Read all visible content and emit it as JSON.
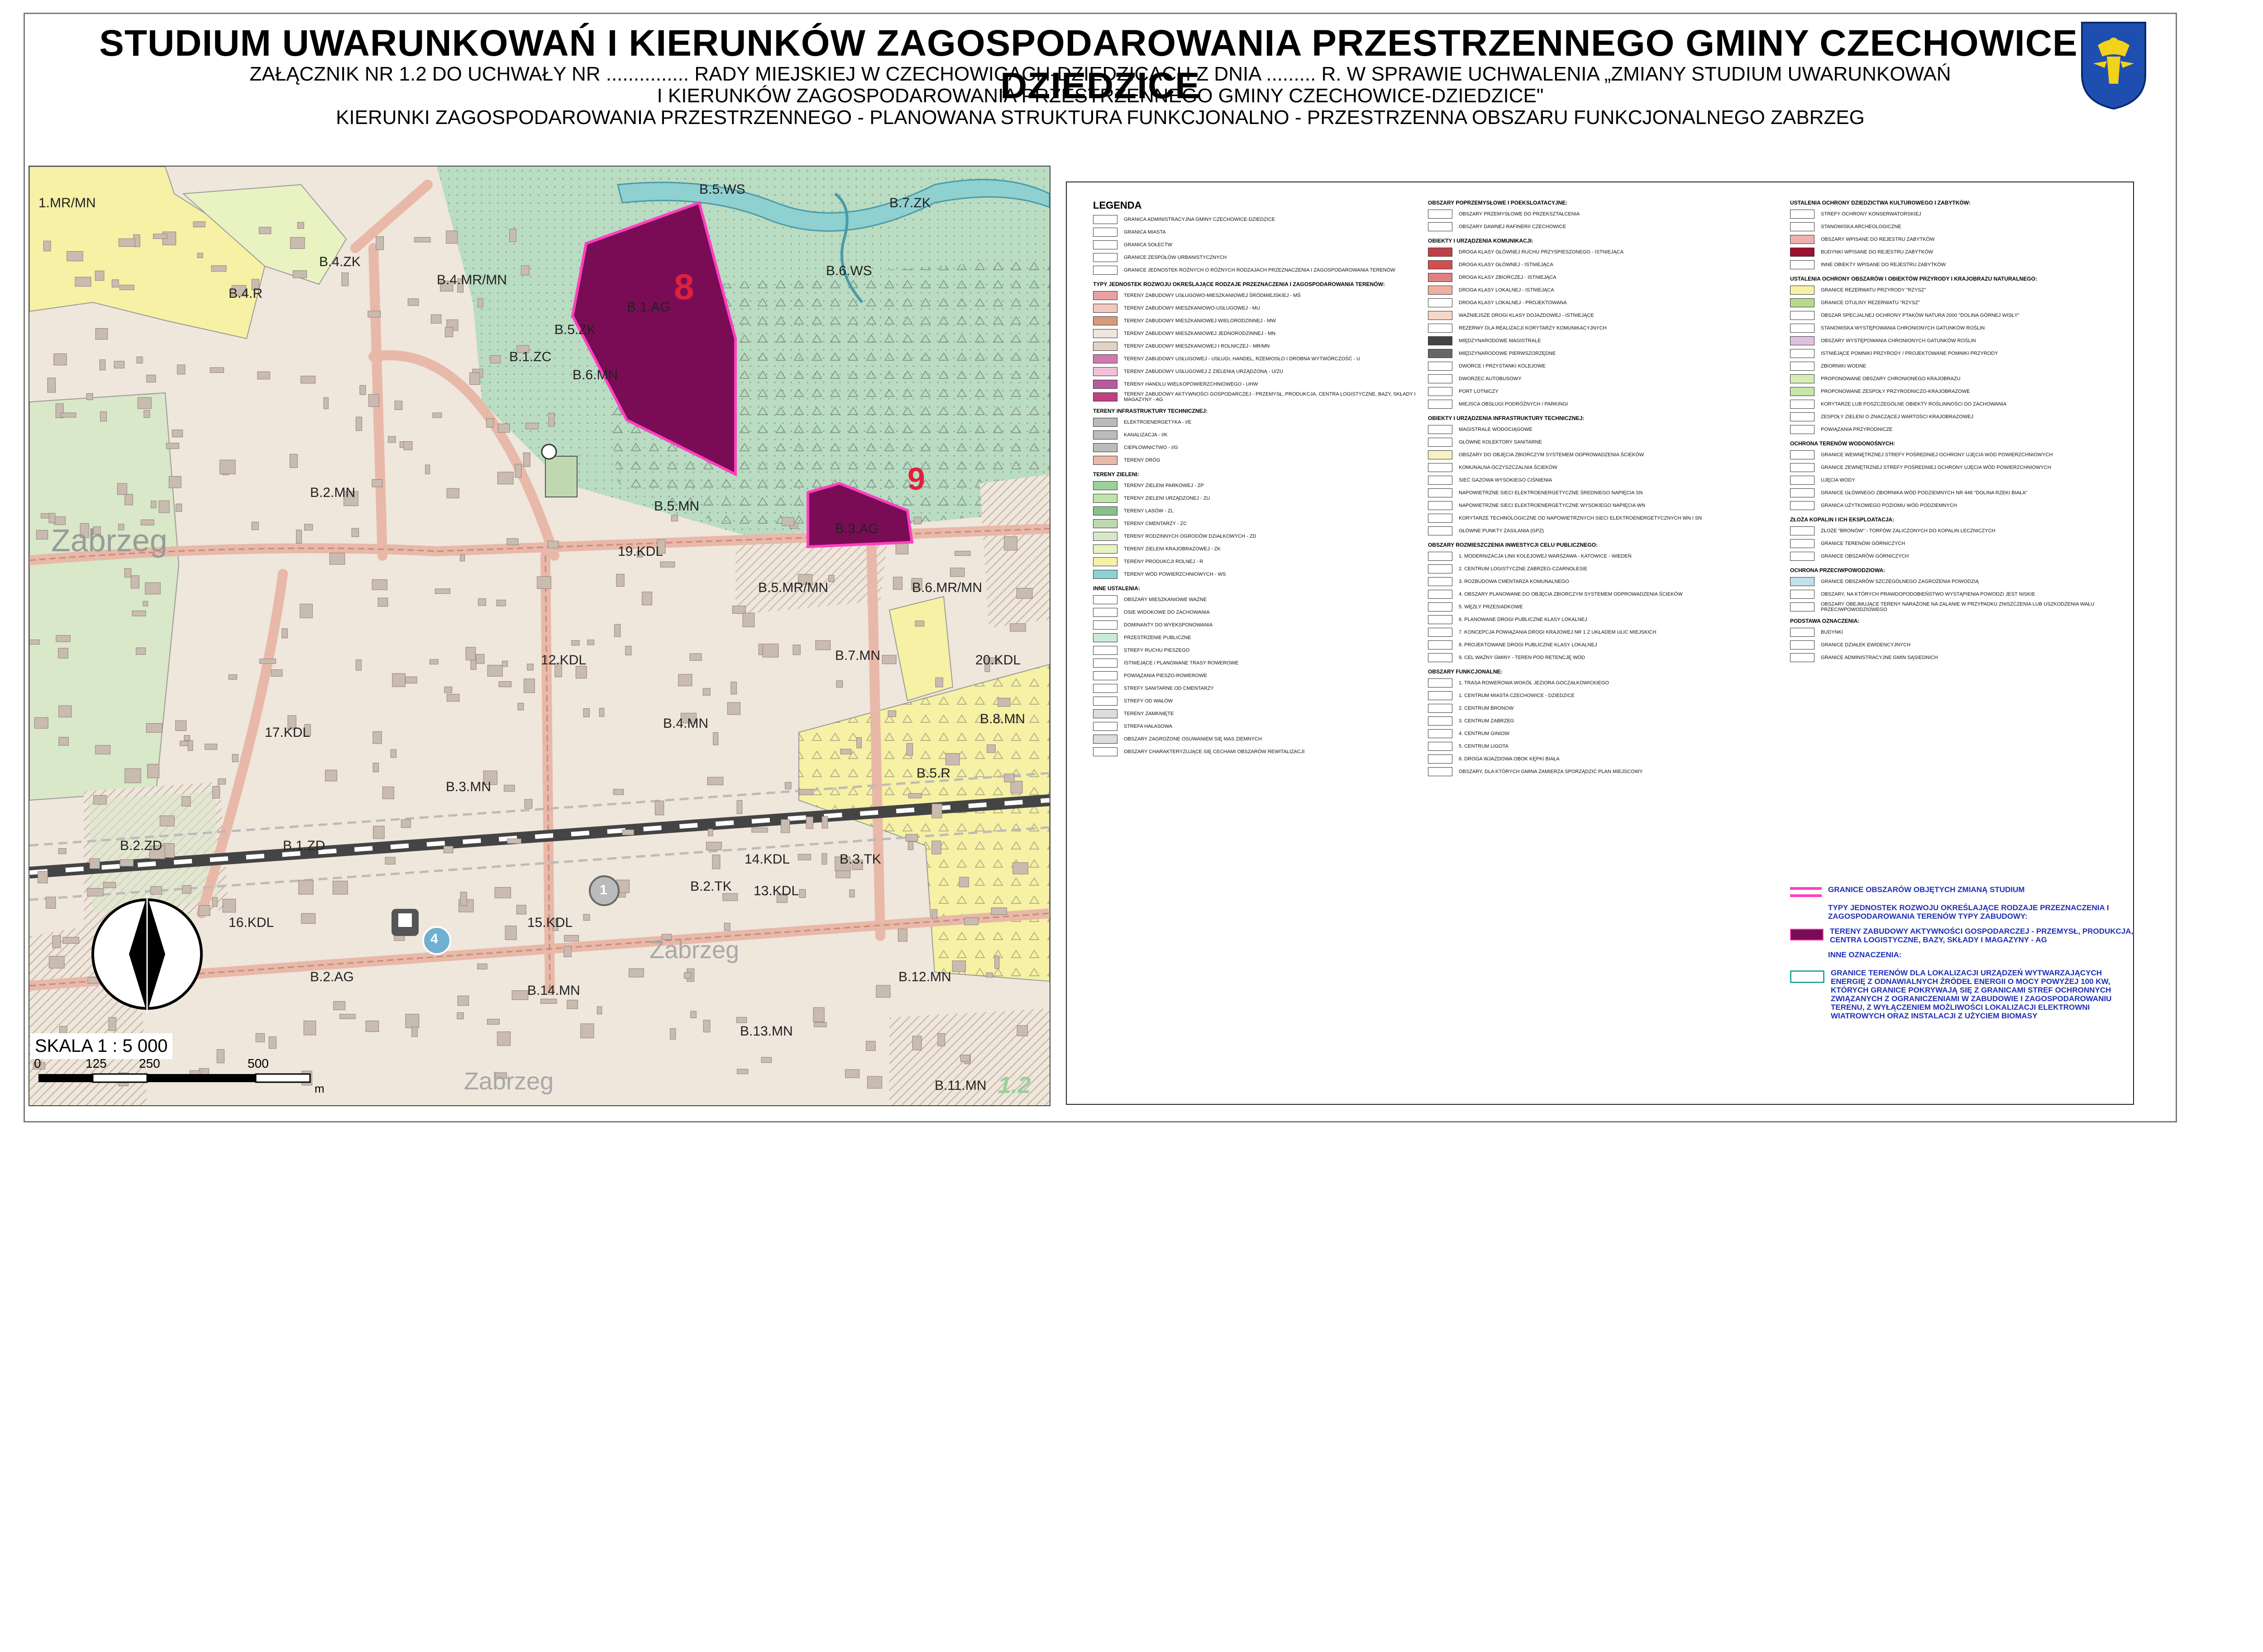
{
  "title": {
    "main": "STUDIUM UWARUNKOWAŃ I KIERUNKÓW ZAGOSPODAROWANIA PRZESTRZENNEGO GMINY CZECHOWICE - DZIEDZICE",
    "line2": "ZAŁĄCZNIK NR 1.2 DO UCHWAŁY NR ............... RADY MIEJSKIEJ W CZECHOWICACH-DZIEDZICACH Z DNIA ......... R. W SPRAWIE UCHWALENIA „ZMIANY STUDIUM UWARUNKOWAŃ",
    "line3": "I KIERUNKÓW ZAGOSPODAROWANIA PRZESTRZENNEGO GMINY CZECHOWICE-DZIEDZICE\"",
    "line4": "KIERUNKI ZAGOSPODAROWANIA PRZESTRZENNEGO - PLANOWANA STRUKTURA FUNKCJONALNO - PRZESTRZENNA OBSZARU FUNKCJONALNEGO ZABRZEG"
  },
  "colors": {
    "residential": "#efe6dc",
    "service_mixed": "#f6f1a4",
    "agri": "#e9f3c2",
    "meadow": "#c9e6d0",
    "forest": "#d8e8c8",
    "water": "#8fd0d0",
    "change_area": "#7a0c55",
    "change_border": "#ff40c0",
    "road": "#e8b8a8",
    "railway": "#444444",
    "blue_text": "#1d2fb8"
  },
  "map": {
    "place_name": "Zabrzeg",
    "place_name_2": "Zabrzeg",
    "place_name_3": "Zabrzeg",
    "sheet_no": "1.2",
    "scale_text": "SKALA 1 : 5 000",
    "scale_ticks": [
      "0",
      "125",
      "250",
      "500"
    ],
    "scale_unit": "m",
    "zones": [
      {
        "id": "1.MR/MN",
        "label": "1.MR/MN"
      },
      {
        "id": "B.4.ZK",
        "label": "B.4.ZK"
      },
      {
        "id": "B.4.R",
        "label": "B.4.R"
      },
      {
        "id": "B.4.MR/MN",
        "label": "B.4.MR/MN"
      },
      {
        "id": "B.5.WS",
        "label": "B.5.WS"
      },
      {
        "id": "B.6.WS",
        "label": "B.6.WS"
      },
      {
        "id": "B.7.ZK",
        "label": "B.7.ZK"
      },
      {
        "id": "B.1.AG",
        "label": "B.1.AG"
      },
      {
        "id": "B.5.ZK",
        "label": "B.5.ZK"
      },
      {
        "id": "B.6.MN",
        "label": "B.6.MN"
      },
      {
        "id": "B.1.ZC",
        "label": "B.1.ZC"
      },
      {
        "id": "B.2.MN",
        "label": "B.2.MN"
      },
      {
        "id": "B.5.MN",
        "label": "B.5.MN"
      },
      {
        "id": "B.3.AG",
        "label": "B.3.AG"
      },
      {
        "id": "19.KDL",
        "label": "19.KDL"
      },
      {
        "id": "B.5.MR/MN",
        "label": "B.5.MR/MN"
      },
      {
        "id": "B.6.MR/MN",
        "label": "B.6.MR/MN"
      },
      {
        "id": "12.KDL",
        "label": "12.KDL"
      },
      {
        "id": "20.KDL",
        "label": "20.KDL"
      },
      {
        "id": "B.7.MN",
        "label": "B.7.MN"
      },
      {
        "id": "17.KDL",
        "label": "17.KDL"
      },
      {
        "id": "B.4.MN",
        "label": "B.4.MN"
      },
      {
        "id": "B.8.MN",
        "label": "B.8.MN"
      },
      {
        "id": "B.5.R",
        "label": "B.5.R"
      },
      {
        "id": "B.3.MN",
        "label": "B.3.MN"
      },
      {
        "id": "B.2.ZD",
        "label": "B.2.ZD"
      },
      {
        "id": "B.1.ZD",
        "label": "B.1.ZD"
      },
      {
        "id": "14.KDL",
        "label": "14.KDL"
      },
      {
        "id": "B.3.TK",
        "label": "B.3.TK"
      },
      {
        "id": "B.2.TK",
        "label": "B.2.TK"
      },
      {
        "id": "13.KDL",
        "label": "13.KDL"
      },
      {
        "id": "16.KDL",
        "label": "16.KDL"
      },
      {
        "id": "15.KDL",
        "label": "15.KDL"
      },
      {
        "id": "B.2.AG",
        "label": "B.2.AG"
      },
      {
        "id": "B.14.MN",
        "label": "B.14.MN"
      },
      {
        "id": "B.12.MN",
        "label": "B.12.MN"
      },
      {
        "id": "B.13.MN",
        "label": "B.13.MN"
      },
      {
        "id": "B.11.MN",
        "label": "B.11.MN"
      }
    ],
    "change_markers": [
      "8",
      "9"
    ],
    "station_markers": [
      "4",
      "1"
    ]
  },
  "legend": {
    "heading": "LEGENDA",
    "col1": [
      {
        "sec": ""
      },
      {
        "t": "GRANICA ADMINISTRACYJNA GMINY CZECHOWICE-DZIEDZICE",
        "c": "#ffffff"
      },
      {
        "t": "GRANICA MIASTA",
        "c": "#ffffff"
      },
      {
        "t": "GRANICA SOŁECTW",
        "c": "#ffffff"
      },
      {
        "t": "GRANICE ZESPOŁÓW URBANISTYCZNYCH",
        "c": "#ffffff"
      },
      {
        "t": "GRANICE JEDNOSTEK ROŻNYCH O RÓŻNYCH RODZAJACH PRZEZNACZENIA I ZAGOSPODAROWANIA TERENÓW",
        "c": "#ffffff"
      },
      {
        "sec": "TYPY JEDNOSTEK ROZWOJU OKREŚLAJĄCE RODZAJE PRZEZNACZENIA I ZAGOSPODAROWANIA TERENÓW:"
      },
      {
        "t": "TERENY ZABUDOWY USŁUGOWO-MIESZKANIOWEJ ŚRÓDMIEJSKIEJ - MŚ",
        "c": "#e9a0a0"
      },
      {
        "t": "TERENY ZABUDOWY MIESZKANIOWO-USŁUGOWEJ - MU",
        "c": "#f2c7c0"
      },
      {
        "t": "TERENY ZABUDOWY MIESZKANIOWEJ WIELORODZINNEJ - MW",
        "c": "#d89a7a"
      },
      {
        "t": "TERENY ZABUDOWY MIESZKANIOWEJ JEDNORODZINNEJ - MN",
        "c": "#efe6dc"
      },
      {
        "t": "TERENY ZABUDOWY MIESZKANIOWEJ I ROLNICZEJ - MR/MN",
        "c": "#e2d3c4"
      },
      {
        "t": "TERENY ZABUDOWY USŁUGOWEJ - USŁUGI, HANDEL, RZEMIOSŁO I DROBNA WYTWÓRCZOŚĆ - U",
        "c": "#d07ab0"
      },
      {
        "t": "TERENY ZABUDOWY USŁUGOWEJ Z ZIELENIĄ URZĄDZONĄ - U/ZU",
        "c": "#f0c0d8"
      },
      {
        "t": "TERENY HANDLU WIELKOPOWIERZCHNIOWEGO - UHW",
        "c": "#b85aa0"
      },
      {
        "t": "TERENY ZABUDOWY AKTYWNOŚCI GOSPODARCZEJ - PRZEMYSŁ, PRODUKCJA, CENTRA LOGISTYCZNE, BAZY, SKŁADY I MAGAZYNY - AG",
        "c": "#c04080"
      },
      {
        "sec": "TERENY INFRASTRUKTURY TECHNICZNEJ:"
      },
      {
        "t": "ELEKTROENERGETYKA - I/E",
        "c": "#bbbbbb"
      },
      {
        "t": "KANALIZACJA - I/K",
        "c": "#bbbbbb"
      },
      {
        "t": "CIEPŁOWNICTWO - I/G",
        "c": "#bbbbbb"
      },
      {
        "t": "TERENY DRÓG",
        "c": "#e8b8a8"
      },
      {
        "sec": "TERENY ZIELENI:"
      },
      {
        "t": "TERENY ZIELENI PARKOWEJ - ZP",
        "c": "#9ad09a"
      },
      {
        "t": "TERENY ZIELENI URZĄDZONEJ - ZU",
        "c": "#bfe3a8"
      },
      {
        "t": "TERENY LASÓW - ZL",
        "c": "#8ac08a"
      },
      {
        "t": "TERENY CMENTARZY - ZC",
        "c": "#c0d8b0"
      },
      {
        "t": "TERENY RODZINNYCH OGRODÓW DZIAŁKOWYCH - ZD",
        "c": "#d8e8c8"
      },
      {
        "t": "TERENY ZIELENI KRAJOBRAZOWEJ - ZK",
        "c": "#e9f3c2"
      },
      {
        "t": "TERENY PRODUKCJI ROLNEJ - R",
        "c": "#f6f1a4"
      },
      {
        "t": "TERENY WÓD POWIERZCHNIOWYCH - WS",
        "c": "#8fd0d0"
      },
      {
        "sec": "INNE USTALENIA:"
      },
      {
        "t": "OBSZARY MIESZKANIOWE WAŻNE",
        "c": "#ffffff"
      },
      {
        "t": "OSIE WIDOKOWE DO ZACHOWANIA",
        "c": "#ffffff"
      },
      {
        "t": "DOMINANTY DO WYEKSPONOWANIA",
        "c": "#ffffff"
      },
      {
        "t": "PRZESTRZENIE PUBLICZNE",
        "c": "#c8ecd8"
      },
      {
        "t": "STREFY RUCHU PIESZEGO",
        "c": "#ffffff"
      },
      {
        "t": "ISTNIEJĄCE / PLANOWANE TRASY ROWEROWE",
        "c": "#ffffff"
      },
      {
        "t": "POWIĄZANIA PIESZO-ROWEROWE",
        "c": "#ffffff"
      },
      {
        "t": "STREFY SANITARNE OD CMENTARZY",
        "c": "#ffffff"
      },
      {
        "t": "STREFY OD WAŁÓW",
        "c": "#ffffff"
      },
      {
        "t": "TERENY ZAMKNIĘTE",
        "c": "#dddddd"
      },
      {
        "t": "STREFA HAŁASOWA",
        "c": "#ffffff"
      },
      {
        "t": "OBSZARY ZAGROŻONE OSUWANIEM SIĘ MAS ZIEMNYCH",
        "c": "#dddddd"
      },
      {
        "t": "OBSZARY CHARAKTERYZUJĄCE SIĘ CECHAMI OBSZARÓW REWITALIZACJI",
        "c": "#ffffff"
      }
    ],
    "col2": [
      {
        "sec": "OBSZARY POPRZEMYSŁOWE I POEKSLOATACYJNE:"
      },
      {
        "t": "OBSZARY PRZEMYSŁOWE DO PRZEKSZTAŁCENIA",
        "c": "#ffffff"
      },
      {
        "t": "OBSZARY DAWNEJ RAFINERII CZECHOWICE",
        "c": "#ffffff"
      },
      {
        "sec": "OBIEKTY I URZĄDZENIA KOMUNIKACJI:"
      },
      {
        "t": "DROGA KLASY GŁÓWNEJ RUCHU PRZYSPIESZONEGO - ISTNIEJĄCA",
        "c": "#c0404a"
      },
      {
        "t": "DROGA KLASY GŁÓWNEJ - ISTNIEJĄCA",
        "c": "#d05050"
      },
      {
        "t": "DROGA KLASY ZBIORCZEJ - ISTNIEJĄCA",
        "c": "#e08080"
      },
      {
        "t": "DROGA KLASY LOKALNEJ - ISTNIEJĄCA",
        "c": "#f0b0a0"
      },
      {
        "t": "DROGA KLASY LOKALNEJ - PROJEKTOWANA",
        "c": "#ffffff"
      },
      {
        "t": "WAŻNIEJSZE DROGI KLASY DOJAZDOWEJ - ISTNIEJĄCE",
        "c": "#f6d8c8"
      },
      {
        "t": "REZERWY DLA REALIZACJI KORYTARZY KOMUNIKACYJNYCH",
        "c": "#ffffff"
      },
      {
        "t": "MIĘDZYNARODOWE MAGISTRALE",
        "c": "#444444"
      },
      {
        "t": "MIĘDZYNARODOWE PIERWSZORZĘDNE",
        "c": "#666666"
      },
      {
        "t": "DWORCE I PRZYSTANKI KOLEJOWE",
        "c": "#ffffff"
      },
      {
        "t": "DWORZEC AUTOBUSOWY",
        "c": "#ffffff"
      },
      {
        "t": "PORT LOTNICZY",
        "c": "#ffffff"
      },
      {
        "t": "MIEJSCA OBSŁUGI PODRÓŻNYCH / PARKINGI",
        "c": "#ffffff"
      },
      {
        "sec": "OBIEKTY I URZĄDZENIA INFRASTRUKTURY TECHNICZNEJ:"
      },
      {
        "t": "MAGISTRALE WODOCIĄGOWE",
        "c": "#ffffff"
      },
      {
        "t": "GŁÓWNE KOLEKTORY SANITARNE",
        "c": "#ffffff"
      },
      {
        "t": "OBSZARY DO OBJĘCIA ZBIORCZYM SYSTEMEM ODPROWADZENIA ŚCIEKÓW",
        "c": "#f6f1c0"
      },
      {
        "t": "KOMUNALNA OCZYSZCZALNIA ŚCIEKÓW",
        "c": "#ffffff"
      },
      {
        "t": "SIEĆ GAZOWA WYSOKIEGO CIŚNIENIA",
        "c": "#ffffff"
      },
      {
        "t": "NAPOWIETRZNE SIECI ELEKTROENERGETYCZNE ŚREDNIEGO NAPIĘCIA SN",
        "c": "#ffffff"
      },
      {
        "t": "NAPOWIETRZNE SIECI ELEKTROENERGETYCZNE WYSOKIEGO NAPIĘCIA WN",
        "c": "#ffffff"
      },
      {
        "t": "KORYTARZE TECHNOLOGICZNE OD NAPOWIETRZNYCH SIECI ELEKTROENERGETYCZNYCH WN I SN",
        "c": "#ffffff"
      },
      {
        "t": "GŁÓWNE PUNKTY ZASILANIA (GPZ)",
        "c": "#ffffff"
      },
      {
        "sec": "OBSZARY ROZMIESZCZENIA INWESTYCJI CELU PUBLICZNEGO:"
      },
      {
        "t": "1. MODERNIZACJA LINII KOLEJOWEJ WARSZAWA - KATOWICE - WIEDEŃ",
        "c": "#ffffff"
      },
      {
        "t": "2. CENTRUM LOGISTYCZNE ZABRZEG-CZARNOLESIE",
        "c": "#ffffff"
      },
      {
        "t": "3. ROZBUDOWA CMENTARZA KOMUNALNEGO",
        "c": "#ffffff"
      },
      {
        "t": "4. OBSZARY PLANOWANE DO OBJĘCIA ZBIORCZYM SYSTEMEM ODPROWADZENIA ŚCIEKÓW",
        "c": "#ffffff"
      },
      {
        "t": "5. WĘZŁY PRZESIADKOWE",
        "c": "#ffffff"
      },
      {
        "t": "6. PLANOWANE DROGI PUBLICZNE KLASY LOKALNEJ",
        "c": "#ffffff"
      },
      {
        "t": "7. KONCEPCJA POWIĄZANIA DROGI KRAJOWEJ NR 1 Z UKŁADEM ULIC MIEJSKICH",
        "c": "#ffffff"
      },
      {
        "t": "8. PROJEKTOWANE DROGI PUBLICZNE KLASY LOKALNEJ",
        "c": "#ffffff"
      },
      {
        "t": "9. CEL WAŻNY GMINY - TEREN POD RETENCJĘ WÓD",
        "c": "#ffffff"
      },
      {
        "sec": "OBSZARY FUNKCJONALNE:"
      },
      {
        "t": "1. TRASA ROWEROWA WOKÓŁ JEZIORA GOCZAŁKOWICKIEGO",
        "c": "#ffffff"
      },
      {
        "t": "1. CENTRUM MIASTA CZECHOWICE - DZIEDZICE",
        "c": "#ffffff"
      },
      {
        "t": "2. CENTRUM BRONOW",
        "c": "#ffffff"
      },
      {
        "t": "3. CENTRUM ZABRZEG",
        "c": "#ffffff"
      },
      {
        "t": "4. CENTRUM GINIOW",
        "c": "#ffffff"
      },
      {
        "t": "5. CENTRUM LIGOTA",
        "c": "#ffffff"
      },
      {
        "t": "6. DROGA WJAZDOWA OBOK KĘPKI BIAŁA",
        "c": "#ffffff"
      },
      {
        "t": "OBSZARY, DLA KTÓRYCH GMINA ZAMIERZA SPORZĄDZIĆ PLAN MIEJSCOWY",
        "c": "#ffffff"
      }
    ],
    "col3": [
      {
        "sec": "USTALENIA OCHRONY DZIEDZICTWA KULTUROWEGO I ZABYTKÓW:"
      },
      {
        "t": "STREFY OCHRONY KONSERWATORSKIEJ",
        "c": "#ffffff"
      },
      {
        "t": "STANOWISKA ARCHEOLOGICZNE",
        "c": "#ffffff"
      },
      {
        "t": "OBSZARY WPISANE DO REJESTRU ZABYTKÓW",
        "c": "#f0b0b0"
      },
      {
        "t": "BUDYNKI WPISANE DO REJESTRU ZABYTKÓW",
        "c": "#a01030"
      },
      {
        "t": "INNE OBIEKTY WPISANE DO REJESTRU ZABYTKÓW",
        "c": "#ffffff"
      },
      {
        "sec": "USTALENIA OCHRONY OBSZARÓW I OBIEKTÓW PRZYRODY I KRAJOBRAZU NATURALNEGO:"
      },
      {
        "t": "GRANICE REZERWATU PRZYRODY \"RZYSZ\"",
        "c": "#f6f1a4"
      },
      {
        "t": "GRANICE OTULINY REZERWATU \"RZYSZ\"",
        "c": "#b8d890"
      },
      {
        "t": "OBSZAR SPECJALNEJ OCHRONY PTAKÓW NATURA 2000 \"DOLINA GÓRNEJ WISŁY\"",
        "c": "#ffffff"
      },
      {
        "t": "STANOWISKA WYSTĘPOWANIA CHRONIONYCH GATUNKÓW ROŚLIN",
        "c": "#ffffff"
      },
      {
        "t": "OBSZARY WYSTĘPOWANIA CHRONIONYCH GATUNKÓW ROŚLIN",
        "c": "#e0c0e0"
      },
      {
        "t": "ISTNIEJĄCE POMNIKI PRZYRODY / PROJEKTOWANE POMNIKI PRZYRODY",
        "c": "#ffffff"
      },
      {
        "t": "ZBIORNIKI WODNE",
        "c": "#ffffff"
      },
      {
        "t": "PROPONOWANE OBSZARY CHRONIONEGO KRAJOBRAZU",
        "c": "#d8ecb8"
      },
      {
        "t": "PROPONOWANE ZESPOŁY PRZYRODNICZO-KRAJOBRAZOWE",
        "c": "#c8e4a8"
      },
      {
        "t": "KORYTARZE LUB POSZCZEGÓLNE OBIEKTY ROŚLINNOŚCI DO ZACHOWANIA",
        "c": "#ffffff"
      },
      {
        "t": "ZESPOŁY ZIELENI O ZNACZĄCEJ WARTOŚCI KRAJOBRAZOWEJ",
        "c": "#ffffff"
      },
      {
        "t": "POWIĄZANIA PRZYRODNICZE",
        "c": "#ffffff"
      },
      {
        "sec": "OCHRONA TERENÓW WODONOŚNYCH:"
      },
      {
        "t": "GRANICE WEWNĘTRZNEJ STREFY POŚREDNIEJ OCHRONY UJĘCIA WÓD POWIERZCHNIOWYCH",
        "c": "#ffffff"
      },
      {
        "t": "GRANICE ZEWNĘTRZNEJ STREFY POŚREDNIEJ OCHRONY UJĘCIA WÓD POWIERZCHNIOWYCH",
        "c": "#ffffff"
      },
      {
        "t": "UJĘCIA WODY",
        "c": "#ffffff"
      },
      {
        "t": "GRANICE GŁÓWNEGO ZBIORNIKA WÓD PODZIEMNYCH NR 448 \"DOLINA RZEKI BIAŁA\"",
        "c": "#ffffff"
      },
      {
        "t": "GRANICA UŻYTKOWEGO POZIOMU WÓD PODZIEMNYCH",
        "c": "#ffffff"
      },
      {
        "sec": "ZŁOŻA KOPALIN I ICH EKSPLOATACJA:"
      },
      {
        "t": "ZŁOŻE \"BRONÓW\" - TORFÓW ZALICZONYCH DO KOPALIN LECZNICZYCH",
        "c": "#ffffff"
      },
      {
        "t": "GRANICE TERENÓW GÓRNICZYCH",
        "c": "#ffffff"
      },
      {
        "t": "GRANICE OBSZARÓW GÓRNICZYCH",
        "c": "#ffffff"
      },
      {
        "sec": "OCHRONA PRZECIWPOWODZIOWA:"
      },
      {
        "t": "GRANICE OBSZARÓW SZCZEGÓLNEGO ZAGROŻENIA POWODZIĄ",
        "c": "#c0e0ec"
      },
      {
        "t": "OBSZARY, NA KTÓRYCH PRAWDOPODOBIEŃSTWO WYSTĄPIENIA POWODZI JEST NISKIE",
        "c": "#ffffff"
      },
      {
        "t": "OBSZARY OBEJMUJĄCE TERENY NARAŻONE NA ZALANIE W PRZYPADKU ZNISZCZENIA LUB USZKODZENIA WAŁU PRZECIWPOWODZIOWEGO",
        "c": "#ffffff"
      },
      {
        "sec": "PODSTAWA OZNACZENIA:"
      },
      {
        "t": "BUDYNKI",
        "c": "#ffffff"
      },
      {
        "t": "GRANICE DZIAŁEK EWIDENCYJNYCH",
        "c": "#ffffff"
      },
      {
        "t": "GRANICE ADMINISTRACYJNE GMIN SĄSIEDNICH",
        "c": "#ffffff"
      }
    ],
    "blue": {
      "b1": "GRANICE OBSZARÓW OBJĘTYCH ZMIANĄ STUDIUM",
      "b2": "TYPY JEDNOSTEK ROZWOJU OKREŚLAJĄCE RODZAJE PRZEZNACZENIA I ZAGOSPODAROWANIA TERENÓW TYPY ZABUDOWY:",
      "b3": "TERENY ZABUDOWY AKTYWNOŚCI GOSPODARCZEJ - PRZEMYSŁ, PRODUKCJA, CENTRA LOGISTYCZNE, BAZY, SKŁADY I MAGAZYNY - AG",
      "b4": "INNE OZNACZENIA:",
      "b5": "GRANICE TERENÓW DLA LOKALIZACJI URZĄDZEŃ WYTWARZAJĄCYCH ENERGIĘ Z ODNAWIALNYCH ŹRÓDEŁ ENERGII O MOCY POWYŻEJ 100 KW, KTÓRYCH GRANICE POKRYWAJĄ SIĘ Z GRANICAMI STREF OCHRONNYCH ZWIĄZANYCH Z OGRANICZENIAMI W ZABUDOWIE I ZAGOSPODAROWANIU TERENU, Z WYŁĄCZENIEM MOŻLIWOŚCI LOKALIZACJI ELEKTROWNI WIATROWYCH ORAZ INSTALACJI Z UŻYCIEM BIOMASY"
    }
  }
}
